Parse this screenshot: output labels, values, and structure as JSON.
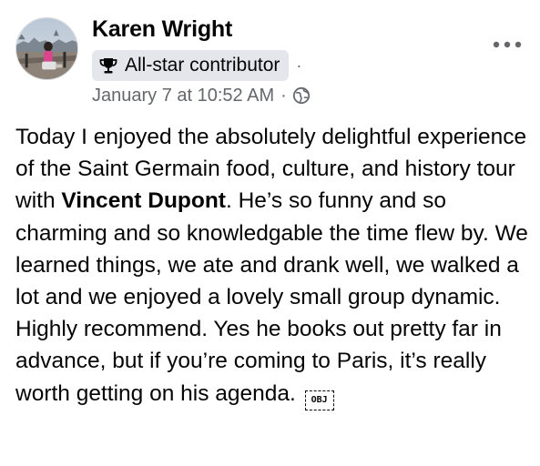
{
  "author": {
    "name": "Karen Wright",
    "badge": "All-star contributor"
  },
  "meta": {
    "separator_after_badge": "·",
    "timestamp": "January 7 at 10:52 AM",
    "separator": "·",
    "audience_icon": "globe-icon"
  },
  "menu": {
    "more_icon": "more-options-icon"
  },
  "post": {
    "text_before_mention": "Today I enjoyed the absolutely delightful experience of the Saint Germain food, culture, and history tour with ",
    "mention": "Vincent Dupont",
    "text_after_mention": ". He’s so funny and so charming and so knowledgable the time flew by. We learned things, we ate and drank well, we walked a lot and we enjoyed a lovely small group dynamic. Highly recommend. Yes he books out pretty far in advance, but if you’re coming to Paris, it’s really worth getting on his agenda. ",
    "trailing_glyph": "OBJ"
  },
  "colors": {
    "text_primary": "#050505",
    "text_secondary": "#65676b",
    "badge_background": "#e4e6eb"
  }
}
